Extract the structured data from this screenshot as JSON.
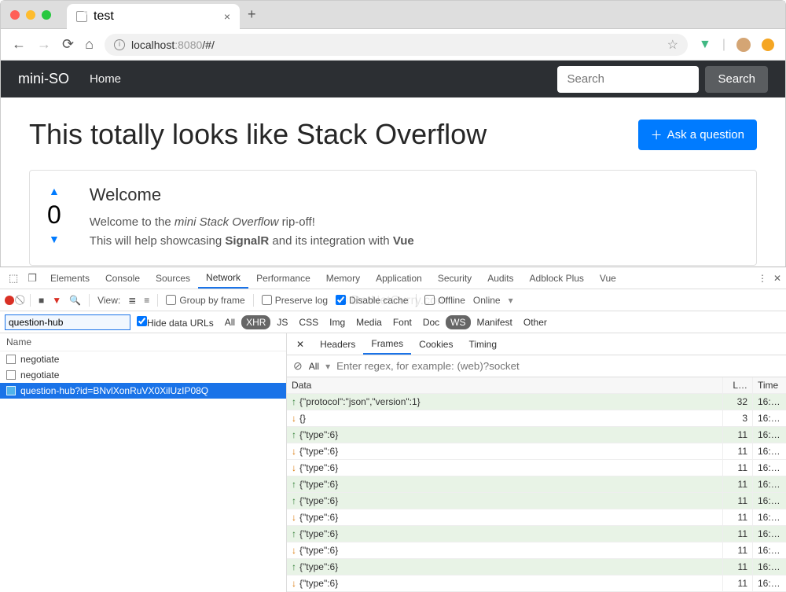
{
  "browser": {
    "tab_title": "test",
    "url_secure_label": "localhost",
    "url_port": ":8080",
    "url_path": "/#/"
  },
  "app": {
    "brand": "mini-SO",
    "home": "Home",
    "search_placeholder": "Search",
    "search_button": "Search",
    "title": "This totally looks like Stack Overflow",
    "ask_button": "Ask a question",
    "card": {
      "votes": "0",
      "heading": "Welcome",
      "line1_pre": "Welcome to the ",
      "line1_em": "mini Stack Overflow",
      "line1_post": " rip-off!",
      "line2_pre": "This will help showcasing ",
      "line2_b1": "SignalR",
      "line2_mid": " and its integration with ",
      "line2_b2": "Vue"
    }
  },
  "devtools": {
    "tabs": [
      "Elements",
      "Console",
      "Sources",
      "Network",
      "Performance",
      "Memory",
      "Application",
      "Security",
      "Audits",
      "Adblock Plus",
      "Vue"
    ],
    "active_tab": "Network",
    "toolbar": {
      "view": "View:",
      "group": "Group by frame",
      "preserve": "Preserve log",
      "disable_cache": "Disable cache",
      "offline": "Offline",
      "online": "Online"
    },
    "filter": {
      "value": "question-hub",
      "hide_data_urls": "Hide data URLs",
      "types": [
        "All",
        "XHR",
        "JS",
        "CSS",
        "Img",
        "Media",
        "Font",
        "Doc",
        "WS",
        "Manifest",
        "Other"
      ],
      "active_types": [
        "XHR",
        "WS"
      ]
    },
    "name_header": "Name",
    "requests": [
      {
        "label": "negotiate",
        "ws": false,
        "sel": false
      },
      {
        "label": "negotiate",
        "ws": false,
        "sel": false
      },
      {
        "label": "question-hub?id=BNvlXonRuVX0XilUzIP08Q",
        "ws": true,
        "sel": true
      }
    ],
    "detail_tabs": [
      "Headers",
      "Frames",
      "Cookies",
      "Timing"
    ],
    "active_detail": "Frames",
    "frame_filter": "All",
    "frame_placeholder": "Enter regex, for example: (web)?socket",
    "frame_cols": {
      "data": "Data",
      "len": "L…",
      "time": "Time"
    },
    "frames": [
      {
        "dir": "up",
        "data": "{\"protocol\":\"json\",\"version\":1}",
        "len": "32",
        "time": "16:…"
      },
      {
        "dir": "down",
        "data": "{}",
        "len": "3",
        "time": "16:…"
      },
      {
        "dir": "up",
        "data": "{\"type\":6}",
        "len": "11",
        "time": "16:…"
      },
      {
        "dir": "down",
        "data": "{\"type\":6}",
        "len": "11",
        "time": "16:…"
      },
      {
        "dir": "down",
        "data": "{\"type\":6}",
        "len": "11",
        "time": "16:…"
      },
      {
        "dir": "up",
        "data": "{\"type\":6}",
        "len": "11",
        "time": "16:…"
      },
      {
        "dir": "up",
        "data": "{\"type\":6}",
        "len": "11",
        "time": "16:…"
      },
      {
        "dir": "down",
        "data": "{\"type\":6}",
        "len": "11",
        "time": "16:…"
      },
      {
        "dir": "up",
        "data": "{\"type\":6}",
        "len": "11",
        "time": "16:…"
      },
      {
        "dir": "down",
        "data": "{\"type\":6}",
        "len": "11",
        "time": "16:…"
      },
      {
        "dir": "up",
        "data": "{\"type\":6}",
        "len": "11",
        "time": "16:…"
      },
      {
        "dir": "down",
        "data": "{\"type\":6}",
        "len": "11",
        "time": "16:…"
      }
    ]
  },
  "watermark": "© DotNetCurry.com"
}
